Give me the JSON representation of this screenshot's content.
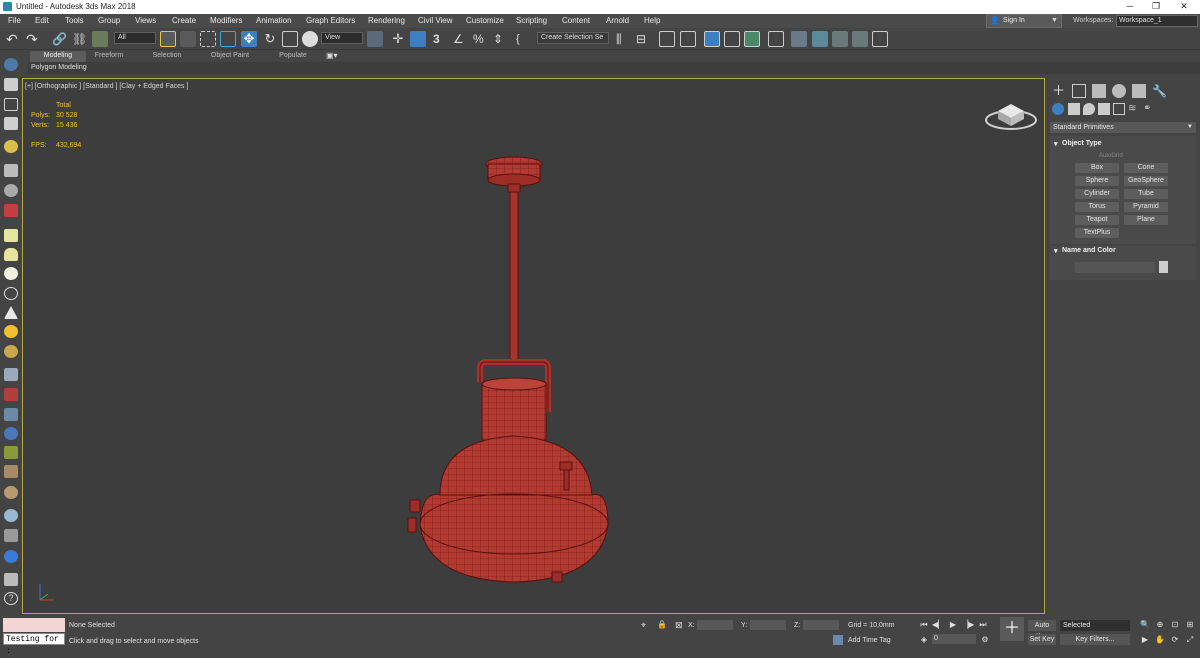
{
  "title_bar": {
    "title": "Untitled - Autodesk 3ds Max 2018",
    "minimize": "─",
    "maximize": "❐",
    "close": "✕"
  },
  "menu": [
    "File",
    "Edit",
    "Tools",
    "Group",
    "Views",
    "Create",
    "Modifiers",
    "Animation",
    "Graph Editors",
    "Rendering",
    "Civil View",
    "Customize",
    "Scripting",
    "Content",
    "Arnold",
    "Help"
  ],
  "account": {
    "sign_in": "Sign In",
    "workspaces_label": "Workspaces:",
    "workspace_value": "Workspace_1"
  },
  "toolbar": {
    "selection_filter": "All",
    "reference_coord": "View",
    "snap_number": "3",
    "selection_set_placeholder": "Create Selection Se"
  },
  "ribbon": {
    "tabs": [
      "Modeling",
      "Freeform",
      "Selection",
      "Object Paint",
      "Populate"
    ],
    "panel_label": "Polygon Modeling"
  },
  "viewport": {
    "label": "[+] [Orthographic ] [Standard ] [Clay + Edged Faces ]",
    "stats": {
      "total_label": "Total",
      "polys_label": "Polys:",
      "polys_value": "30 528",
      "verts_label": "Verts:",
      "verts_value": "15 436",
      "fps_label": "FPS:",
      "fps_value": "432,694"
    },
    "model_color": "#a8322b"
  },
  "command_panel": {
    "category": "Standard Primitives",
    "object_type_title": "Object Type",
    "autogrid": "AutoGrid",
    "primitives": [
      "Box",
      "Cone",
      "Sphere",
      "GeoSphere",
      "Cylinder",
      "Tube",
      "Torus",
      "Pyramid",
      "Teapot",
      "Plane",
      "TextPlus"
    ],
    "name_color_title": "Name and Color"
  },
  "status": {
    "selection_status": "None Selected",
    "prompt": "Click and drag to select and move objects",
    "maxscript_text": "Testing for :",
    "x_label": "X:",
    "y_label": "Y:",
    "z_label": "Z:",
    "grid": "Grid = 10,0mm",
    "add_time_tag": "Add Time Tag",
    "auto_key": "Auto Key",
    "set_key": "Set Key",
    "key_mode": "Selected",
    "key_filters": "Key Filters...",
    "frame": "0"
  }
}
